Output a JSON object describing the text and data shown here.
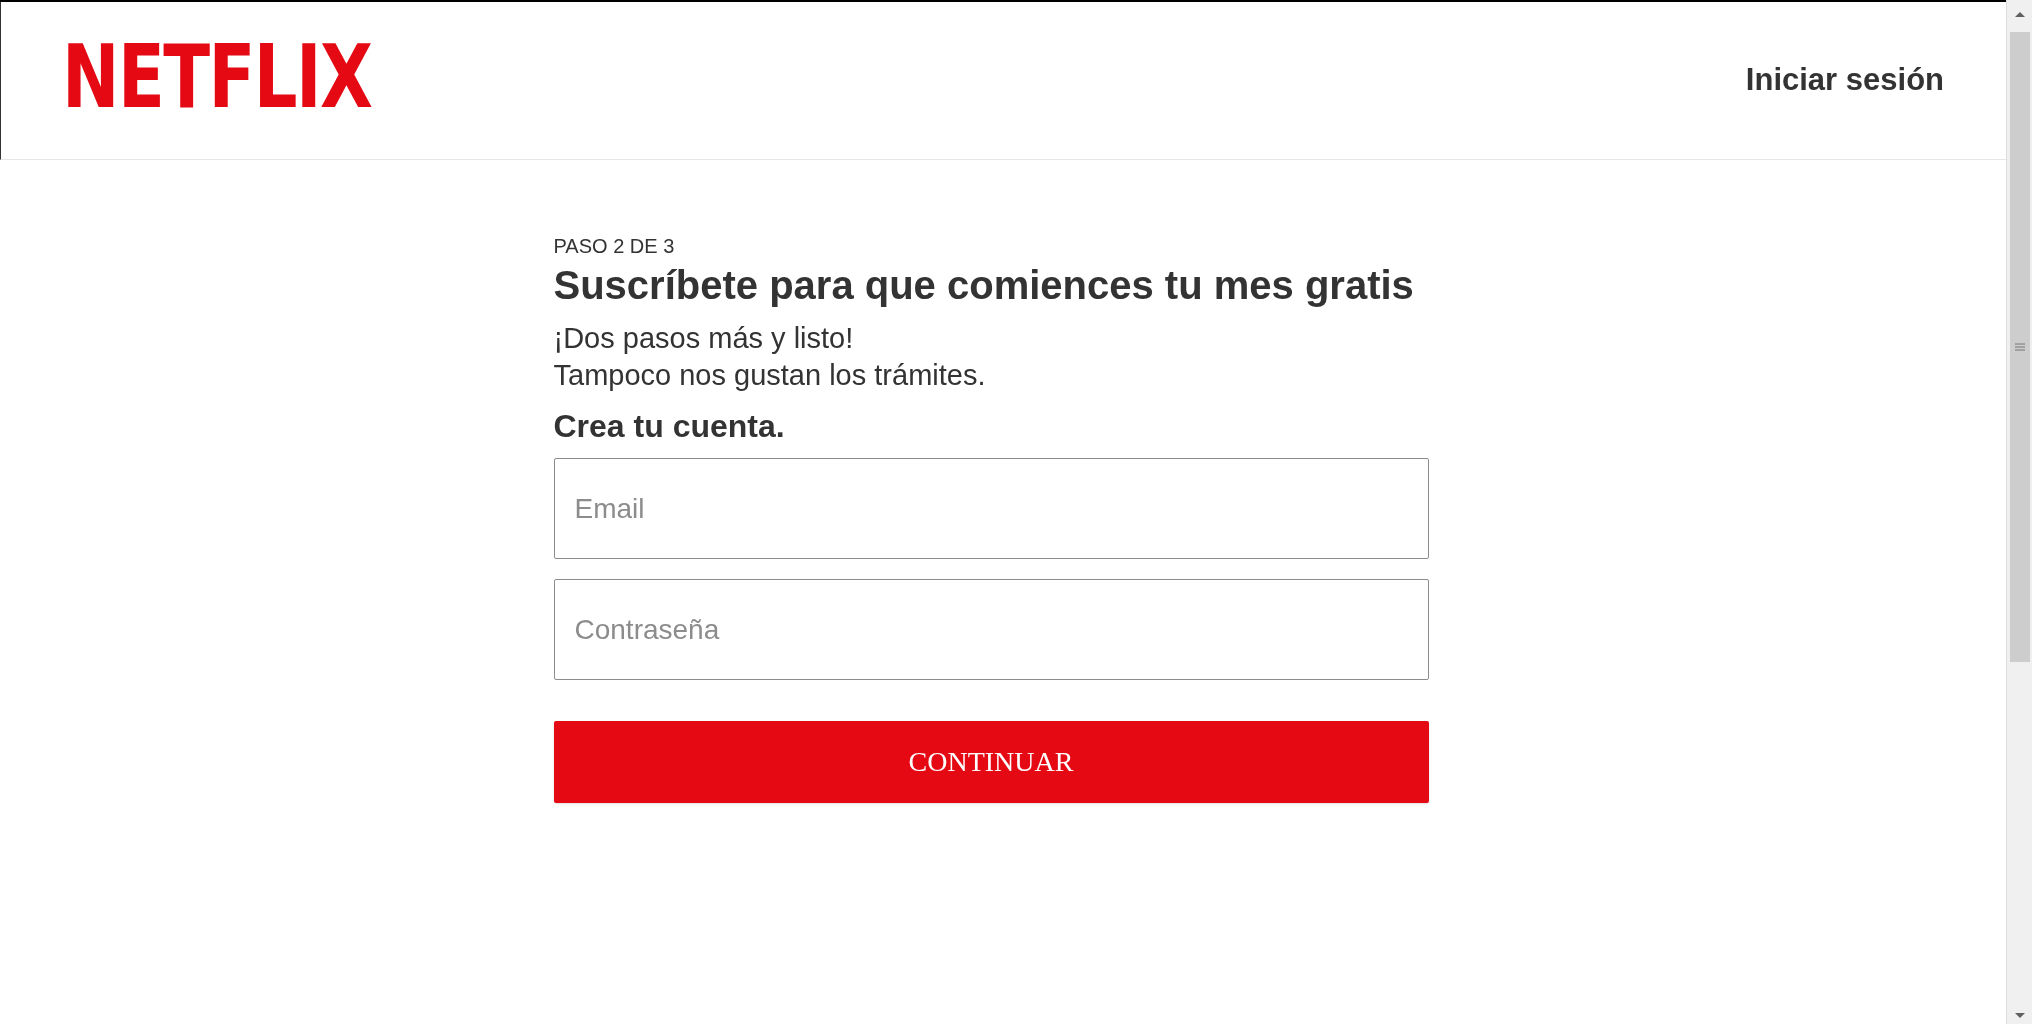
{
  "header": {
    "logo": "NETFLIX",
    "sign_in": "Iniciar sesión"
  },
  "step": "PASO 2 DE 3",
  "title": "Suscríbete para que comiences tu mes gratis",
  "subtitle_lines": [
    "¡Dos pasos más y listo!",
    "Tampoco nos gustan los trámites."
  ],
  "form_title": "Crea tu cuenta.",
  "fields": [
    {
      "placeholder": "Email"
    },
    {
      "placeholder": "Contraseña"
    }
  ],
  "button": "CONTINUAR"
}
